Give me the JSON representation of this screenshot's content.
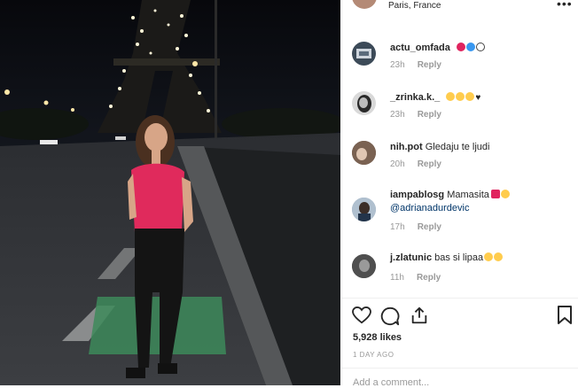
{
  "post": {
    "location": "Paris, France",
    "likes": "5,928 likes",
    "time": "1 DAY AGO",
    "add_comment_placeholder": "Add a comment..."
  },
  "comments": [
    {
      "user": "actu_omfada",
      "text": "",
      "time": "23h",
      "reply": "Reply"
    },
    {
      "user": "_zrinka.k._",
      "text": "",
      "time": "23h",
      "reply": "Reply"
    },
    {
      "user": "nih.pot",
      "text": "Gledaju te ljudi",
      "time": "20h",
      "reply": "Reply"
    },
    {
      "user": "iampablosg",
      "text": "Mamasita",
      "mention": "@adrianadurdevic",
      "time": "17h",
      "reply": "Reply"
    },
    {
      "user": "j.zlatunic",
      "text": "bas si lipaa",
      "time": "11h",
      "reply": "Reply"
    }
  ],
  "colors": {
    "heart_emoji_blue": "#3897f0",
    "emoji_yellow": "#ffcc4d",
    "emoji_red": "#e0245e",
    "mention_blue": "#003569"
  },
  "icons": [
    "heart-icon",
    "comment-icon",
    "share-icon",
    "bookmark-icon"
  ]
}
